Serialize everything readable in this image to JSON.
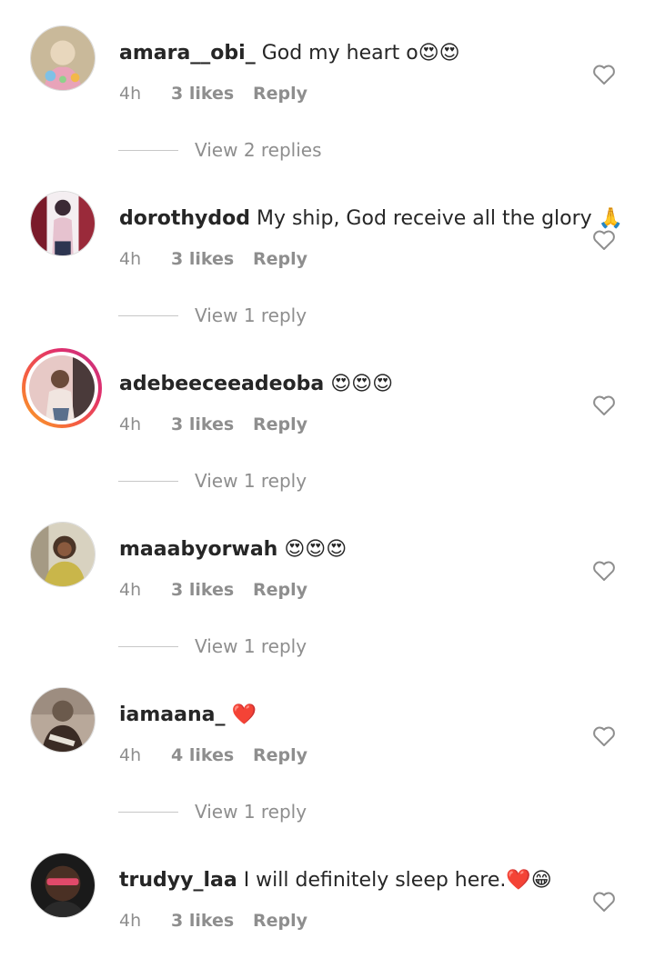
{
  "comments": [
    {
      "username": "amara__obi_",
      "text": "God my heart o😍😍",
      "time": "4h",
      "likes": "3 likes",
      "reply_label": "Reply",
      "view_replies": "View 2 replies",
      "avatar_colors": [
        "#c9b99a",
        "#e8a3b9",
        "#7fc1e6"
      ]
    },
    {
      "username": "dorothydod",
      "text": "My ship, God receive all the glory 🙏",
      "time": "4h",
      "likes": "3 likes",
      "reply_label": "Reply",
      "view_replies": "View 1 reply",
      "avatar_colors": [
        "#7a1a2a",
        "#e6c2cf",
        "#3b2a35"
      ]
    },
    {
      "username": "adebeeceeadeoba",
      "text": "😍😍😍",
      "time": "4h",
      "likes": "3 likes",
      "reply_label": "Reply",
      "view_replies": "View 1 reply",
      "avatar_colors": [
        "#e7c9c6",
        "#5a6f8c",
        "#f0e5e0"
      ]
    },
    {
      "username": "maaabyorwah",
      "text": "😍😍😍",
      "time": "4h",
      "likes": "3 likes",
      "reply_label": "Reply",
      "view_replies": "View 1 reply",
      "avatar_colors": [
        "#d8d2c0",
        "#4a3426",
        "#c9b64a"
      ]
    },
    {
      "username": "iamaana_",
      "text": "❤️",
      "time": "4h",
      "likes": "4 likes",
      "reply_label": "Reply",
      "view_replies": "View 1 reply",
      "avatar_colors": [
        "#6b5a4c",
        "#3a2b24",
        "#b8a89a"
      ]
    },
    {
      "username": "trudyy_laa",
      "text": "I will definitely  sleep here.❤️😁",
      "time": "4h",
      "likes": "3 likes",
      "reply_label": "Reply",
      "view_replies": "",
      "avatar_colors": [
        "#1a1a1a",
        "#e04a6a",
        "#4a3024"
      ]
    }
  ],
  "icons": {
    "like": "heart-outline-icon"
  },
  "colors": {
    "text": "#262626",
    "muted": "#8e8e8e",
    "story_ring": "#f56040"
  }
}
